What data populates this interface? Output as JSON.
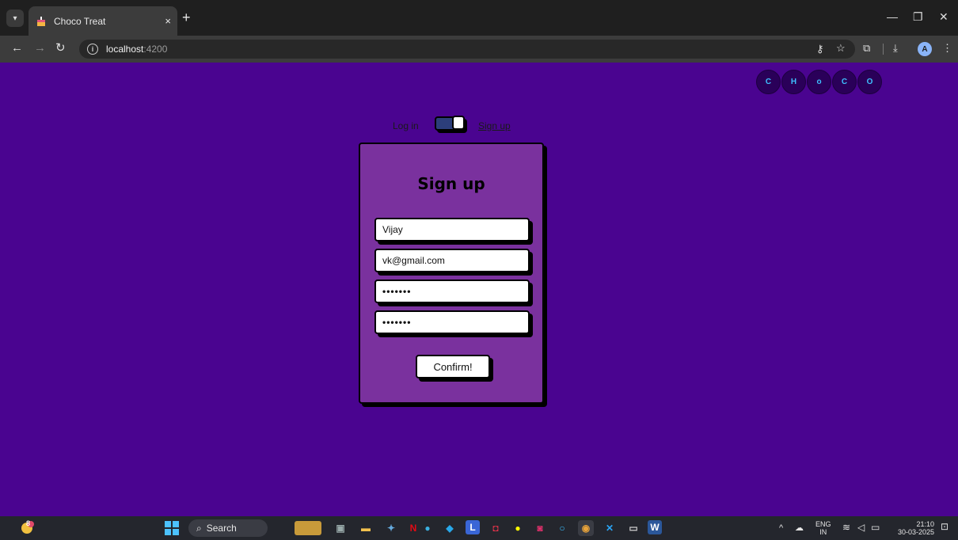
{
  "browser": {
    "tab_title": "Choco Treat",
    "tab_close": "×",
    "new_tab": "+",
    "address_host": "localhost",
    "address_port": ":4200",
    "profile_initial": "A"
  },
  "window_controls": {
    "minimize": "—",
    "restore": "❐",
    "close": "✕"
  },
  "logo": {
    "letters": [
      "C",
      "H",
      "o",
      "C",
      "O"
    ]
  },
  "toggle": {
    "login_label": "Log in",
    "signup_label": "Sign up",
    "state": "signup"
  },
  "signup_form": {
    "title": "Sign up",
    "name_value": "Vijay",
    "email_value": "vk@gmail.com",
    "password_value": "•••••••",
    "confirm_password_value": "•••••••",
    "submit_label": "Confirm!"
  },
  "taskbar": {
    "search_label": "Search",
    "language": "ENG",
    "region": "IN",
    "time": "21:10",
    "date": "30-03-2025",
    "weather_badge": "8"
  },
  "colors": {
    "page_bg": "#4a0490",
    "card_bg": "#7a319e",
    "logo_bg": "#2a0059",
    "logo_text": "#3ec0ff"
  }
}
